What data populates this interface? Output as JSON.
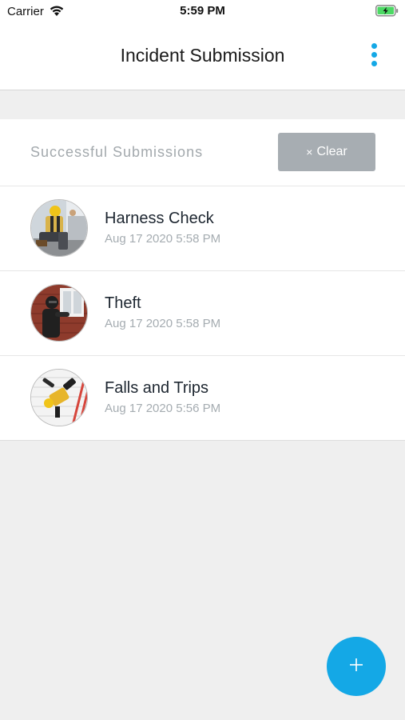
{
  "status_bar": {
    "carrier": "Carrier",
    "time": "5:59 PM",
    "wifi_icon": "wifi-icon",
    "battery_icon": "battery-charging-icon"
  },
  "nav": {
    "title": "Incident Submission",
    "more_icon": "more-vertical-icon"
  },
  "section": {
    "title": "Successful Submissions",
    "clear_icon": "×",
    "clear_label": "Clear"
  },
  "submissions": [
    {
      "title": "Harness Check",
      "date": "Aug 17 2020 5:58 PM",
      "thumbnail": "harness-worker-photo"
    },
    {
      "title": "Theft",
      "date": "Aug 17 2020 5:58 PM",
      "thumbnail": "burglar-window-photo"
    },
    {
      "title": "Falls and Trips",
      "date": "Aug 17 2020 5:56 PM",
      "thumbnail": "ladder-fall-photo"
    }
  ],
  "fab": {
    "icon": "plus-icon"
  },
  "colors": {
    "accent": "#14a8e6",
    "clear_button": "#a7adb2",
    "background": "#efefef",
    "secondary_text": "#a5acb1"
  }
}
